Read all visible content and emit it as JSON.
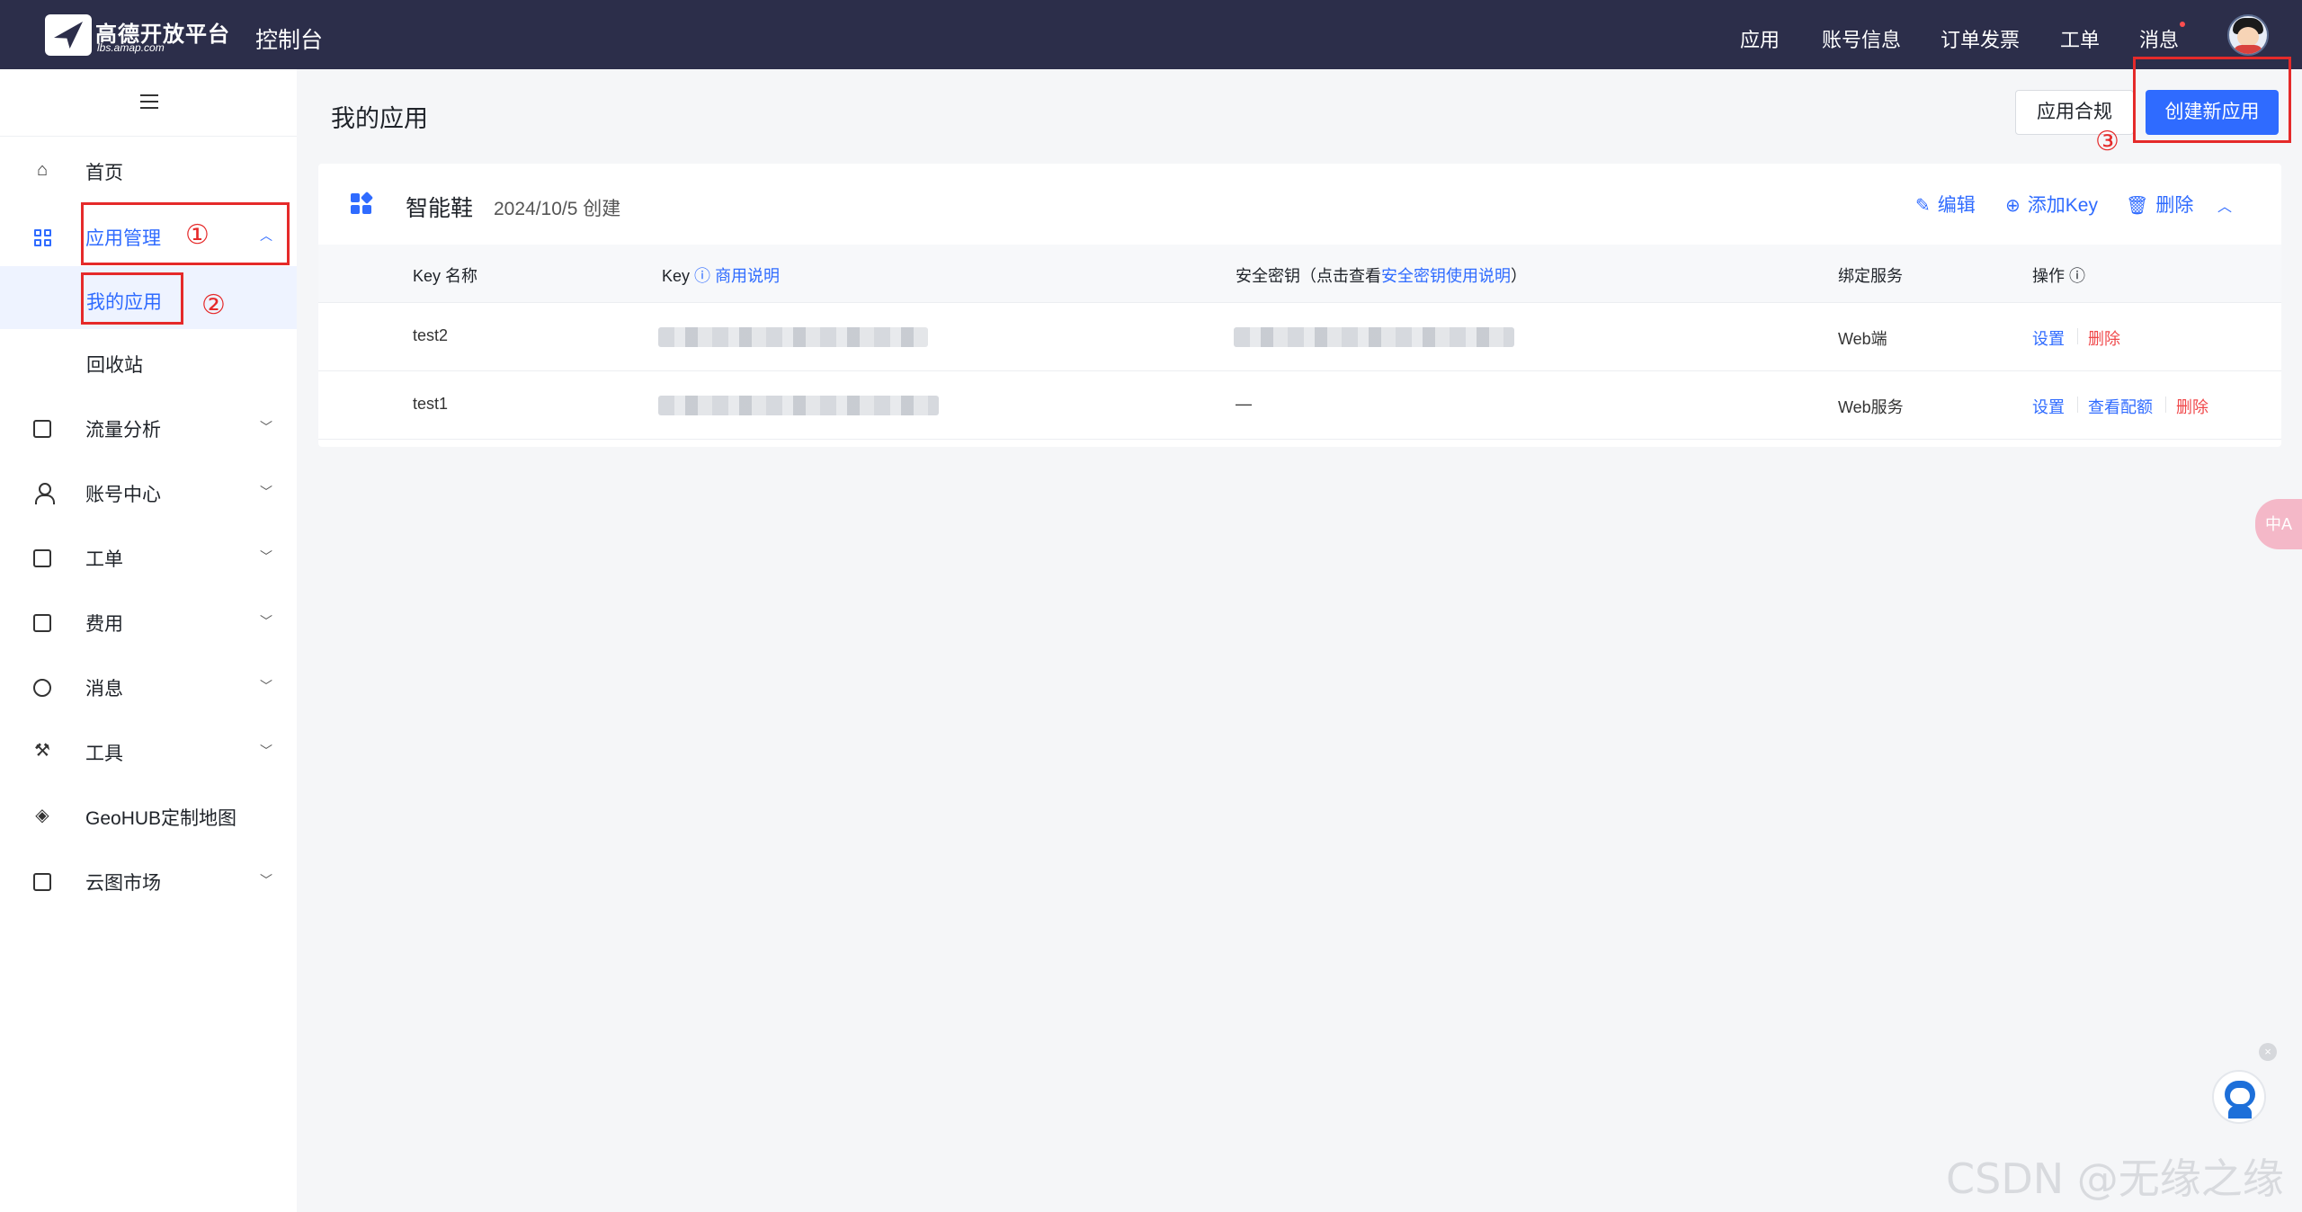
{
  "topbar": {
    "logo_name": "高德开放平台",
    "logo_sub": "lbs.amap.com",
    "console_title": "控制台",
    "nav": [
      {
        "label": "应用"
      },
      {
        "label": "账号信息"
      },
      {
        "label": "订单发票"
      },
      {
        "label": "工单"
      },
      {
        "label": "消息"
      }
    ]
  },
  "sidebar": {
    "items": [
      {
        "label": "首页",
        "icon": "home-icon"
      },
      {
        "label": "应用管理",
        "icon": "grid-icon",
        "expanded": true
      },
      {
        "label": "流量分析",
        "icon": "chart-icon"
      },
      {
        "label": "账号中心",
        "icon": "user-icon"
      },
      {
        "label": "工单",
        "icon": "ticket-icon"
      },
      {
        "label": "费用",
        "icon": "yen-icon"
      },
      {
        "label": "消息",
        "icon": "chat-icon"
      },
      {
        "label": "工具",
        "icon": "wrench-icon"
      },
      {
        "label": "GeoHUB定制地图",
        "icon": "layers-icon"
      },
      {
        "label": "云图市场",
        "icon": "store-icon"
      }
    ],
    "sub_items": [
      {
        "label": "我的应用",
        "current": true
      },
      {
        "label": "回收站"
      }
    ]
  },
  "main": {
    "page_title": "我的应用",
    "compliance_button": "应用合规",
    "create_button": "创建新应用"
  },
  "app_card": {
    "name": "智能鞋",
    "created": "2024/10/5 创建",
    "actions": {
      "edit": "编辑",
      "add_key": "添加Key",
      "delete": "删除"
    },
    "columns": {
      "key_name": "Key 名称",
      "key": "Key",
      "key_help": "商用说明",
      "secret_prefix": "安全密钥（点击查看",
      "secret_link": "安全密钥使用说明",
      "secret_suffix": "）",
      "service": "绑定服务",
      "ops": "操作"
    },
    "rows": [
      {
        "name": "test2",
        "secret": "",
        "service": "Web端",
        "ops": [
          "设置",
          "删除"
        ]
      },
      {
        "name": "test1",
        "secret": "—",
        "service": "Web服务",
        "ops": [
          "设置",
          "查看配额",
          "删除"
        ]
      }
    ]
  },
  "annotations": [
    "①",
    "②",
    "③"
  ],
  "floating": {
    "translate": "中A",
    "close": "×"
  },
  "watermark": "CSDN @无缘之缘",
  "colors": {
    "topbar": "#2c2e4a",
    "accent": "#2f6bff",
    "danger": "#f0484a",
    "annotation": "#e52a2a"
  }
}
